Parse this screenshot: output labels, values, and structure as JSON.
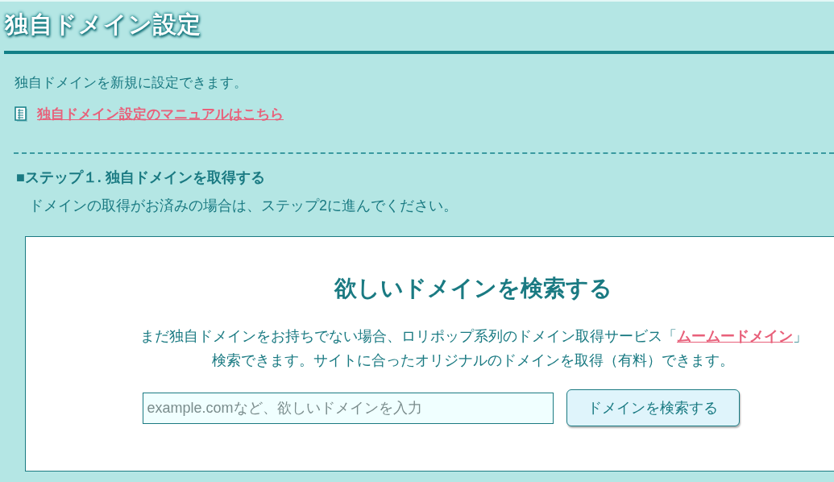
{
  "page_title": "独自ドメイン設定",
  "intro": "独自ドメインを新規に設定できます。",
  "manual_link": "独自ドメイン設定のマニュアルはこちら",
  "step": {
    "heading": "■ステップ１. 独自ドメインを取得する",
    "note": "ドメインの取得がお済みの場合は、ステップ2に進んでください。"
  },
  "search_panel": {
    "heading": "欲しいドメインを検索する",
    "line_1_before": "まだ独自ドメインをお持ちでない場合、ロリポップ系列のドメイン取得サービス「",
    "line_1_link": "ムームードメイン",
    "line_1_after": "」",
    "line_2": "検索できます。サイトに合ったオリジナルのドメインを取得（有料）できます。",
    "search_field": {
      "placeholder": "example.comなど、欲しいドメインを入力"
    },
    "search_button": "ドメインを検索する"
  }
}
